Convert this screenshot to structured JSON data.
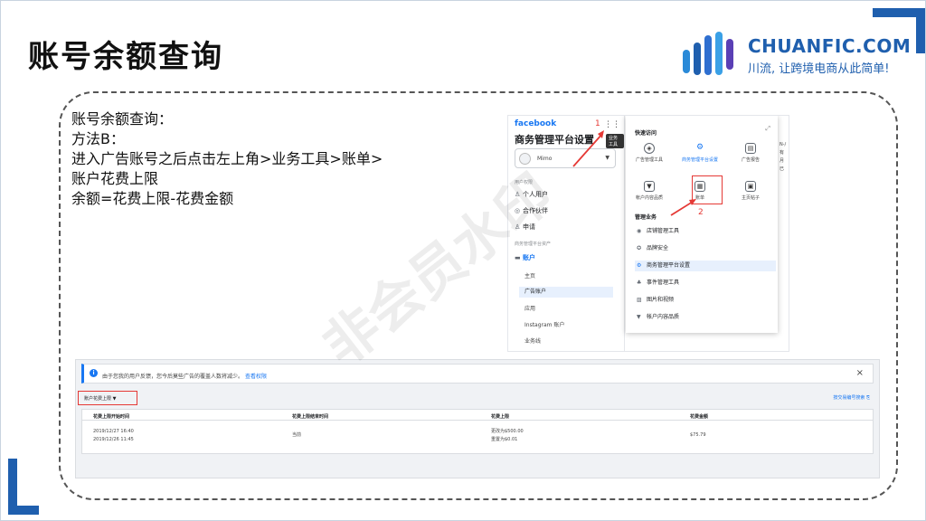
{
  "slide": {
    "title": "账号余额查询",
    "watermark": "非会员水印"
  },
  "logo": {
    "name": "CHUANFIC.COM",
    "slogan": "川流, 让跨境电商从此简单!"
  },
  "description": {
    "lines": [
      "账号余额查询：",
      "方法B：",
      "进入广告账号之后点击左上角>业务工具>账单>",
      "账户花费上限",
      "余额=花费上限-花费金额"
    ]
  },
  "fb_settings": {
    "logo": "facebook",
    "heading": "商务管理平台设置",
    "user_name": "Mimo",
    "tooltip": "业务工具",
    "section_users": "用户权限",
    "nav_users": "个人用户",
    "nav_partners": "合作伙伴",
    "nav_requests": "申请",
    "section_assets": "商务管理平台资产",
    "nav_accounts": "账户",
    "sub_items": [
      "主页",
      "广告账户",
      "应用",
      "Instagram 账户",
      "业务线"
    ],
    "annotation_1": "1",
    "annotation_2": "2",
    "right_edge": [
      "N-/",
      "有",
      "月",
      "已"
    ]
  },
  "quick_panel": {
    "title": "快速访问",
    "quick_items": [
      {
        "label": "广告管理工具",
        "icon": "compass-icon"
      },
      {
        "label": "商务管理平台设置",
        "icon": "gear-icon"
      },
      {
        "label": "广告报告",
        "icon": "report-icon"
      },
      {
        "label": "帐户内容品质",
        "icon": "shield-icon"
      },
      {
        "label": "账单",
        "icon": "billing-icon"
      },
      {
        "label": "主页帖子",
        "icon": "posts-icon"
      }
    ],
    "manage_title": "管理业务",
    "manage_items": [
      {
        "label": "店铺管理工具",
        "icon": "store-icon"
      },
      {
        "label": "品牌安全",
        "icon": "brand-safety-icon"
      },
      {
        "label": "商务管理平台设置",
        "icon": "gear-icon"
      },
      {
        "label": "事件管理工具",
        "icon": "events-icon"
      },
      {
        "label": "图片和视频",
        "icon": "media-icon"
      },
      {
        "label": "帐户内容品质",
        "icon": "shield-icon"
      }
    ]
  },
  "billing": {
    "notice_text": "由于您我的用户反馈，您今后莫些广告的覆盖人数将减少。",
    "notice_link": "查看权限",
    "dropdown_label": "账户花费上限",
    "search_link": "按交易编号搜索",
    "columns": [
      "花费上限开始时间",
      "花费上限结束时间",
      "花费上限",
      "花费金额"
    ],
    "row": {
      "start_times": [
        "2019/12/27 16:40",
        "2019/12/26 11:45"
      ],
      "end_time": "当前",
      "limits": [
        "更改为$500.00",
        "重置为$0.01"
      ],
      "spent": "$75.79"
    }
  }
}
